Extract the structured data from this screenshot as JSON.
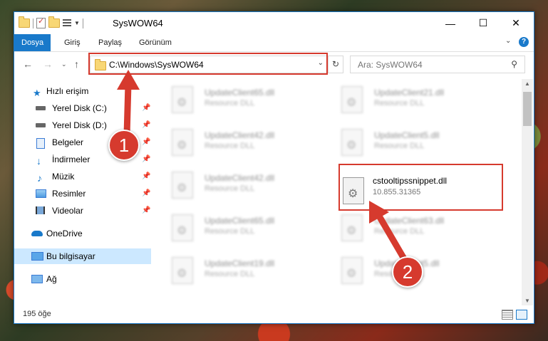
{
  "window": {
    "title": "SysWOW64",
    "minimize_label": "—",
    "maximize_label": "☐",
    "close_label": "✕"
  },
  "ribbon": {
    "tabs": [
      "Dosya",
      "Giriş",
      "Paylaş",
      "Görünüm"
    ],
    "help_label": "?"
  },
  "address": {
    "path": "C:\\Windows\\SysWOW64",
    "search_placeholder": "Ara: SysWOW64"
  },
  "sidebar": {
    "quick_access": "Hızlı erişim",
    "items": [
      {
        "label": "Yerel Disk (C:)",
        "icon": "drive-icon"
      },
      {
        "label": "Yerel Disk (D:)",
        "icon": "drive-icon"
      },
      {
        "label": "Belgeler",
        "icon": "documents-icon"
      },
      {
        "label": "İndirmeler",
        "icon": "downloads-icon"
      },
      {
        "label": "Müzik",
        "icon": "music-icon"
      },
      {
        "label": "Resimler",
        "icon": "pictures-icon"
      },
      {
        "label": "Videolar",
        "icon": "videos-icon"
      }
    ],
    "onedrive": "OneDrive",
    "this_pc": "Bu bilgisayar",
    "network": "Ağ"
  },
  "files": [
    {
      "name": "UpdateClient65.dll",
      "type": "Resource DLL"
    },
    {
      "name": "UpdateClient21.dll",
      "type": "Resource DLL"
    },
    {
      "name": "UpdateClient42.dll",
      "type": "Resource DLL"
    },
    {
      "name": "UpdateClient5.dll",
      "type": "Resource DLL"
    },
    {
      "name": "UpdateClient42.dll",
      "type": "Resource DLL"
    },
    {
      "name": "cstooltipssnippet.dll",
      "type": "10.855.31365"
    },
    {
      "name": "UpdateClient65.dll",
      "type": "Resource DLL"
    },
    {
      "name": "UpdateClient63.dll",
      "type": "Resource DLL"
    },
    {
      "name": "UpdateClient19.dll",
      "type": "Resource DLL"
    },
    {
      "name": "UpdateClient5.dll",
      "type": "Resource DLL"
    }
  ],
  "status": {
    "item_count": "195 öğe"
  },
  "annotations": {
    "step1": "1",
    "step2": "2",
    "color": "#d63a2e"
  }
}
